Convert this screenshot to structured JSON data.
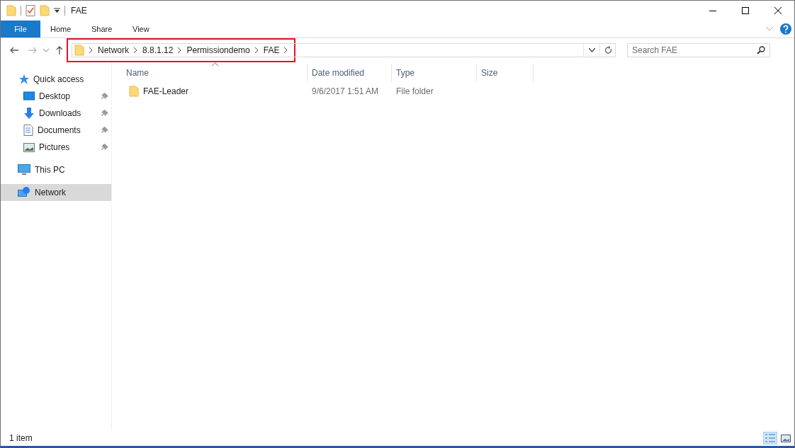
{
  "window": {
    "title": "FAE"
  },
  "ribbon": {
    "tabs": [
      {
        "label": "File",
        "kind": "file"
      },
      {
        "label": "Home",
        "kind": "tab"
      },
      {
        "label": "Share",
        "kind": "tab"
      },
      {
        "label": "View",
        "kind": "tab"
      }
    ]
  },
  "address": {
    "segments": [
      "Network",
      "8.8.1.12",
      "Permissiondemo",
      "FAE"
    ],
    "highlighted": true
  },
  "search": {
    "placeholder": "Search FAE"
  },
  "nav": [
    {
      "label": "Quick access",
      "kind": "star",
      "selected": false,
      "children": [
        {
          "label": "Desktop",
          "kind": "desktop",
          "pinned": true,
          "selected": false
        },
        {
          "label": "Downloads",
          "kind": "download",
          "pinned": true,
          "selected": false
        },
        {
          "label": "Documents",
          "kind": "documents",
          "pinned": true,
          "selected": false
        },
        {
          "label": "Pictures",
          "kind": "pictures",
          "pinned": true,
          "selected": false
        }
      ]
    },
    {
      "label": "This PC",
      "kind": "pc",
      "selected": false
    },
    {
      "label": "Network",
      "kind": "network",
      "selected": true
    }
  ],
  "table": {
    "columns": [
      {
        "label": "Name",
        "sorted": true
      },
      {
        "label": "Date modified",
        "sorted": false
      },
      {
        "label": "Type",
        "sorted": false
      },
      {
        "label": "Size",
        "sorted": false
      }
    ],
    "rows": [
      {
        "name": "FAE-Leader",
        "date": "9/6/2017 1:51 AM",
        "type": "File folder",
        "selected": false
      }
    ]
  },
  "status_bar": {
    "text": "1 item",
    "views": [
      {
        "kind": "details",
        "selected": true
      },
      {
        "kind": "large",
        "selected": false
      }
    ]
  }
}
